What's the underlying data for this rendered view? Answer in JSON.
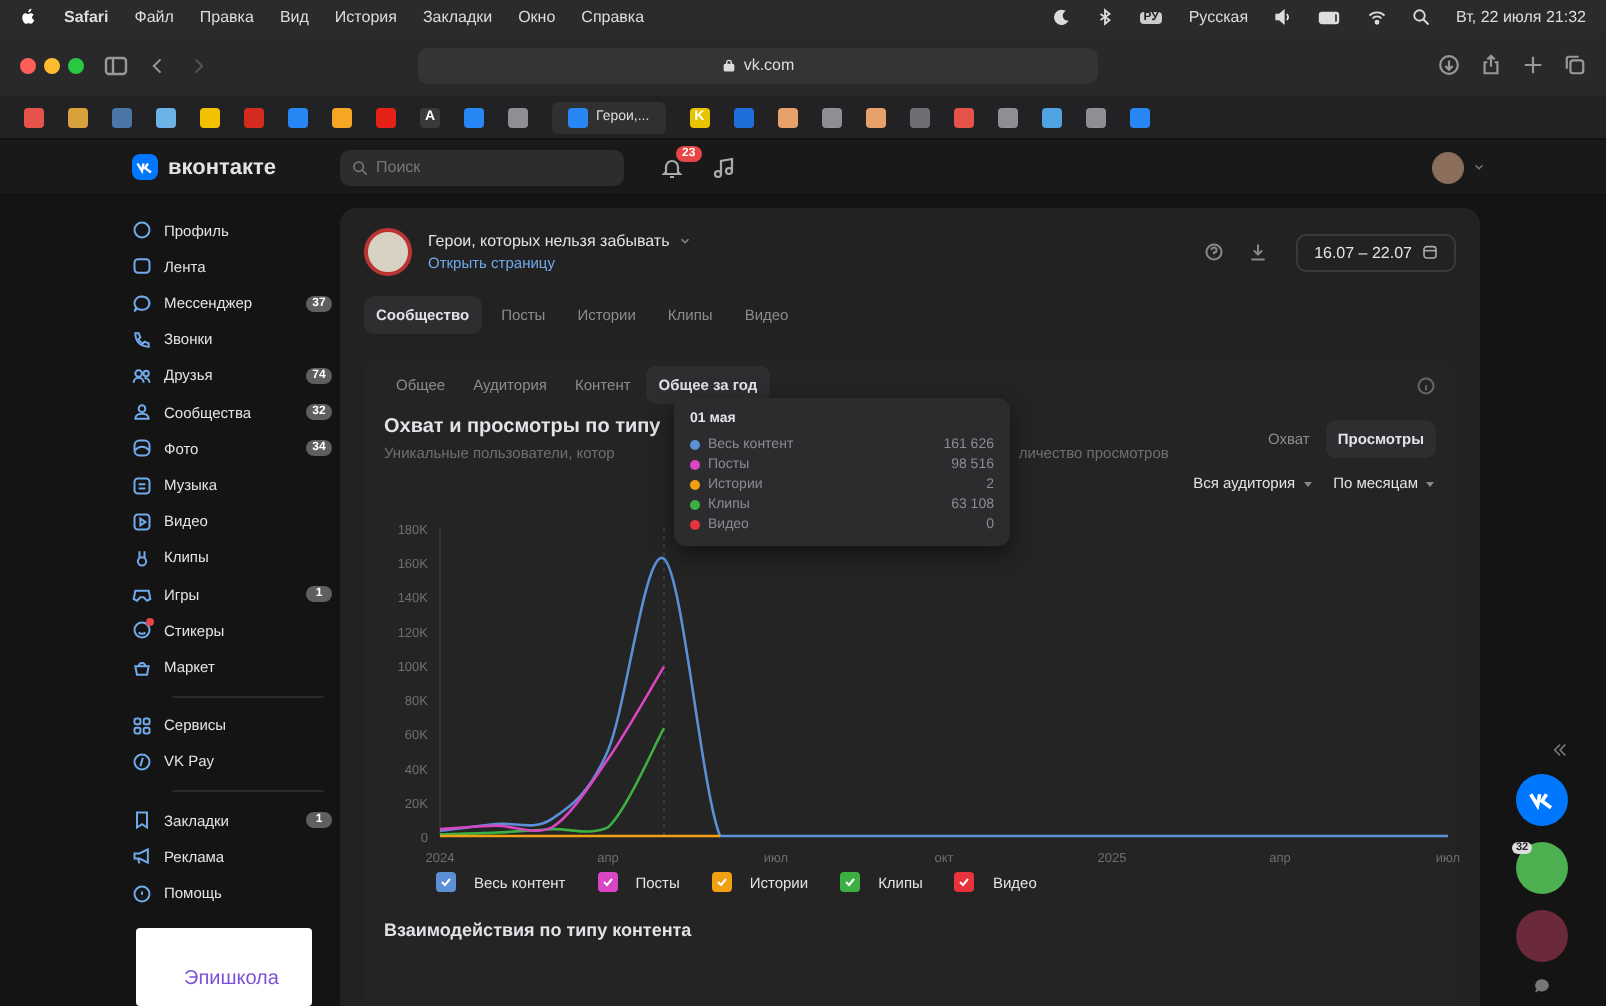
{
  "menu_bar": {
    "app": "Safari",
    "menus": [
      "Файл",
      "Правка",
      "Вид",
      "История",
      "Закладки",
      "Окно",
      "Справка"
    ],
    "keyboard_badge": "РУ",
    "keyboard_layout": "Русская",
    "clock": "Вт, 22 июля 21:32"
  },
  "browser": {
    "address": "vk.com",
    "bookmarks": [
      {
        "kind": "icon",
        "color": "#e5534b"
      },
      {
        "kind": "icon",
        "color": "#d9a13b"
      },
      {
        "kind": "icon",
        "color": "#4a76a8"
      },
      {
        "kind": "icon",
        "color": "#6cb4e8"
      },
      {
        "kind": "icon",
        "color": "#f2c200"
      },
      {
        "kind": "icon",
        "color": "#d52b1e"
      },
      {
        "kind": "icon",
        "color": "#2787f5"
      },
      {
        "kind": "icon",
        "color": "#f5a623"
      },
      {
        "kind": "icon",
        "color": "#e62117"
      },
      {
        "kind": "letter",
        "letter": "A",
        "color": "#3a3a3a"
      },
      {
        "kind": "icon",
        "color": "#2787f5"
      },
      {
        "kind": "icon",
        "color": "#8e8e93"
      },
      {
        "kind": "tab",
        "label": "Герои,...",
        "color": "#2787f5"
      },
      {
        "kind": "letter",
        "letter": "K",
        "color": "#e8c300"
      },
      {
        "kind": "icon",
        "color": "#1e6fd9"
      },
      {
        "kind": "icon",
        "color": "#e8a06a"
      },
      {
        "kind": "icon",
        "color": "#8e8e93"
      },
      {
        "kind": "icon",
        "color": "#e8a06a"
      },
      {
        "kind": "icon",
        "color": "#6e6e73"
      },
      {
        "kind": "icon",
        "color": "#e5534b"
      },
      {
        "kind": "icon",
        "color": "#8e8e93"
      },
      {
        "kind": "icon",
        "color": "#4fa3e0"
      },
      {
        "kind": "icon",
        "color": "#8e8e93"
      },
      {
        "kind": "icon",
        "color": "#2787f5"
      }
    ]
  },
  "vk_header": {
    "logo": "вконтакте",
    "search_placeholder": "Поиск",
    "notifications_badge": "23"
  },
  "sidebar": {
    "groups": [
      [
        {
          "label": "Профиль",
          "alert": false
        },
        {
          "label": "Лента",
          "alert": false
        },
        {
          "label": "Мессенджер",
          "badge": "37",
          "alert": false
        },
        {
          "label": "Звонки",
          "alert": false
        },
        {
          "label": "Друзья",
          "badge": "74",
          "alert": false
        },
        {
          "label": "Сообщества",
          "badge": "32",
          "alert": false
        },
        {
          "label": "Фото",
          "badge": "34",
          "alert": false
        },
        {
          "label": "Музыка",
          "alert": false
        },
        {
          "label": "Видео",
          "alert": false
        },
        {
          "label": "Клипы",
          "alert": false
        },
        {
          "label": "Игры",
          "badge": "1",
          "alert": false
        },
        {
          "label": "Стикеры",
          "alert": true
        },
        {
          "label": "Маркет",
          "alert": false
        }
      ],
      [
        {
          "label": "Сервисы",
          "alert": false
        },
        {
          "label": "VK Pay",
          "alert": false
        }
      ],
      [
        {
          "label": "Закладки",
          "badge": "1",
          "alert": false
        },
        {
          "label": "Реклама",
          "alert": false
        },
        {
          "label": "Помощь",
          "alert": false
        }
      ]
    ],
    "ad": {
      "title": "Эпишкола"
    }
  },
  "community": {
    "name": "Герои, которых нельзя забывать",
    "link": "Открыть страницу",
    "date_range": "16.07 – 22.07",
    "tabs": [
      {
        "label": "Сообщество",
        "selected": true
      },
      {
        "label": "Посты",
        "selected": false
      },
      {
        "label": "Истории",
        "selected": false
      },
      {
        "label": "Клипы",
        "selected": false
      },
      {
        "label": "Видео",
        "selected": false
      }
    ],
    "subtabs": [
      {
        "label": "Общее",
        "selected": false
      },
      {
        "label": "Аудитория",
        "selected": false
      },
      {
        "label": "Контент",
        "selected": false
      },
      {
        "label": "Общее за год",
        "selected": true
      }
    ],
    "section": {
      "title": "Охват и просмотры по типу",
      "subtitle_start": "Уникальные пользователи, котор",
      "subtitle_end": "личество просмотров",
      "metrics": [
        {
          "label": "Охват",
          "selected": false
        },
        {
          "label": "Просмотры",
          "selected": true
        }
      ],
      "filters": [
        "Вся аудитория",
        "По месяцам"
      ],
      "chart_data": {
        "type": "line",
        "categories": [
          "2024",
          null,
          null,
          "апр",
          null,
          null,
          "июл",
          null,
          null,
          "окт",
          null,
          null,
          "2025",
          null,
          null,
          "апр",
          null,
          null,
          "июл"
        ],
        "series": [
          {
            "name": "Весь контент",
            "color": "#5b8fd6",
            "values": [
              3000,
              7000,
              10000,
              50000,
              162000,
              0,
              0,
              0,
              0,
              0,
              0,
              0,
              0,
              0,
              0,
              0,
              0,
              0,
              0
            ]
          },
          {
            "name": "Посты",
            "color": "#d946c4",
            "values": [
              4000,
              6000,
              5000,
              45000,
              99000,
              null,
              null,
              null,
              null,
              null,
              null,
              null,
              null,
              null,
              null,
              null,
              null,
              null,
              null
            ]
          },
          {
            "name": "Истории",
            "color": "#f0a010",
            "values": [
              0,
              0,
              0,
              0,
              0,
              0,
              null,
              null,
              null,
              null,
              null,
              null,
              null,
              null,
              null,
              null,
              null,
              null,
              null
            ]
          },
          {
            "name": "Клипы",
            "color": "#3cb043",
            "values": [
              1000,
              2000,
              4000,
              5000,
              63000,
              null,
              null,
              null,
              null,
              null,
              null,
              null,
              null,
              null,
              null,
              null,
              null,
              null,
              null
            ]
          },
          {
            "name": "Видео",
            "color": "#e8323c",
            "values": [
              null,
              null,
              null,
              null,
              null,
              null,
              null,
              null,
              null,
              null,
              null,
              null,
              null,
              null,
              null,
              null,
              null,
              null,
              null
            ]
          }
        ],
        "yticks": [
          {
            "value": 0,
            "label": "0"
          },
          {
            "value": 20000,
            "label": "20K"
          },
          {
            "value": 40000,
            "label": "40K"
          },
          {
            "value": 60000,
            "label": "60K"
          },
          {
            "value": 80000,
            "label": "80K"
          },
          {
            "value": 100000,
            "label": "100K"
          },
          {
            "value": 120000,
            "label": "120K"
          },
          {
            "value": 140000,
            "label": "140K"
          },
          {
            "value": 160000,
            "label": "160K"
          },
          {
            "value": 180000,
            "label": "180K"
          }
        ],
        "ylim": [
          0,
          180000
        ]
      },
      "legend": [
        {
          "checked": true
        },
        {
          "checked": true
        },
        {
          "checked": true
        },
        {
          "checked": true
        },
        {
          "checked": true
        }
      ],
      "tooltip": {
        "date": "01 мая",
        "rows": [
          {
            "label": "Весь контент",
            "color": "#5b8fd6",
            "value": "161 626"
          },
          {
            "label": "Посты",
            "color": "#d946c4",
            "value": "98 516"
          },
          {
            "label": "Истории",
            "color": "#f0a010",
            "value": "2"
          },
          {
            "label": "Клипы",
            "color": "#3cb043",
            "value": "63 108"
          },
          {
            "label": "Видео",
            "color": "#e8323c",
            "value": "0"
          }
        ]
      }
    },
    "next_section_title": "Взаимодействия по типу контента"
  },
  "right_rail": {
    "avatar_badge": "32"
  }
}
